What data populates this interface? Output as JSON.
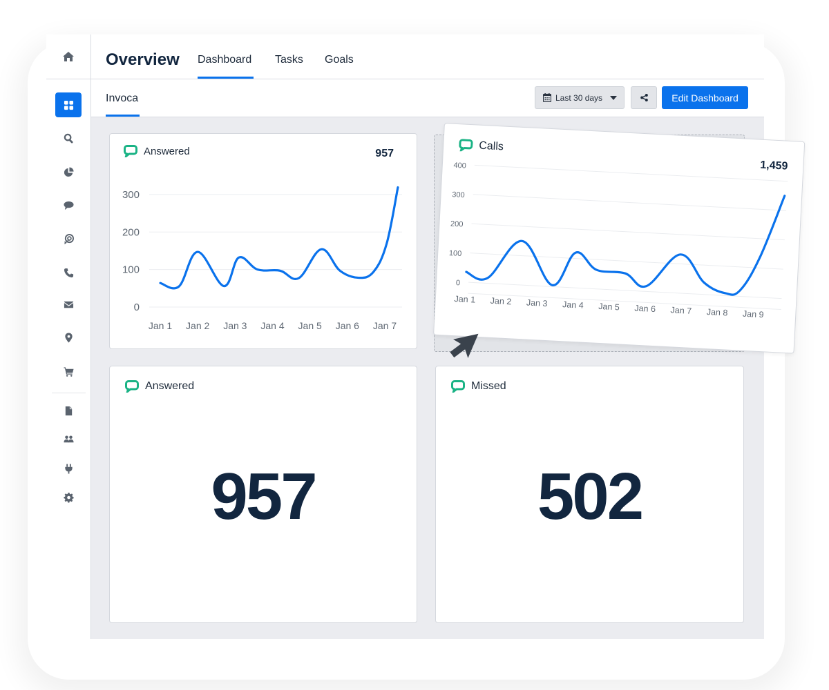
{
  "header": {
    "title": "Overview",
    "tabs": [
      {
        "label": "Dashboard",
        "active": true
      },
      {
        "label": "Tasks",
        "active": false
      },
      {
        "label": "Goals",
        "active": false
      }
    ]
  },
  "subheader": {
    "tab": "Invoca",
    "date_range": "Last 30 days",
    "edit_button": "Edit Dashboard"
  },
  "sidebar": {
    "items": [
      {
        "icon": "home-icon"
      },
      {
        "icon": "dashboard-grid-icon",
        "active": true
      },
      {
        "icon": "search-icon"
      },
      {
        "icon": "pie-chart-icon"
      },
      {
        "icon": "chat-bubble-icon"
      },
      {
        "icon": "target-icon"
      },
      {
        "icon": "phone-icon"
      },
      {
        "icon": "envelope-icon"
      },
      {
        "icon": "map-pin-icon"
      },
      {
        "icon": "shopping-cart-icon"
      },
      {
        "icon": "document-icon"
      },
      {
        "icon": "users-icon"
      },
      {
        "icon": "plug-icon"
      },
      {
        "icon": "gear-icon"
      }
    ]
  },
  "colors": {
    "accent": "#0a72ec",
    "line": "#0a72ec",
    "icon_green": "#1ab385",
    "title_dark": "#12263f"
  },
  "widgets": {
    "answered_chart": {
      "title": "Answered",
      "total": "957"
    },
    "calls_chart": {
      "title": "Calls",
      "total": "1,459"
    },
    "answered_number": {
      "title": "Answered",
      "value": "957"
    },
    "missed_number": {
      "title": "Missed",
      "value": "502"
    }
  },
  "chart_data": [
    {
      "type": "line",
      "title": "Answered",
      "total": "957",
      "categories": [
        "Jan 1",
        "Jan 2",
        "Jan 3",
        "Jan 4",
        "Jan 5",
        "Jan 6",
        "Jan 7"
      ],
      "yticks": [
        0,
        100,
        200,
        300
      ],
      "ylim": [
        0,
        320
      ],
      "grid": true,
      "x": [
        0.0,
        0.5,
        1.0,
        1.7,
        2.1,
        2.6,
        3.2,
        3.7,
        4.3,
        4.8,
        5.3,
        5.7,
        6.05,
        6.35
      ],
      "values": [
        64,
        55,
        147,
        56,
        132,
        100,
        97,
        77,
        154,
        97,
        78,
        94,
        169,
        319
      ]
    },
    {
      "type": "line",
      "title": "Calls",
      "total": "1,459",
      "categories": [
        "Jan 1",
        "Jan 2",
        "Jan 3",
        "Jan 4",
        "Jan 5",
        "Jan 6",
        "Jan 7",
        "Jan 8",
        "Jan 9"
      ],
      "yticks": [
        0,
        100,
        200,
        300,
        400
      ],
      "ylim": [
        0,
        400
      ],
      "grid": true,
      "x": [
        0.0,
        0.6,
        1.5,
        2.4,
        3.0,
        3.6,
        4.4,
        5.0,
        5.9,
        6.6,
        7.2,
        7.6,
        8.1,
        8.7
      ],
      "values": [
        35,
        18,
        150,
        5,
        120,
        65,
        58,
        18,
        132,
        40,
        8,
        20,
        135,
        350
      ]
    }
  ]
}
